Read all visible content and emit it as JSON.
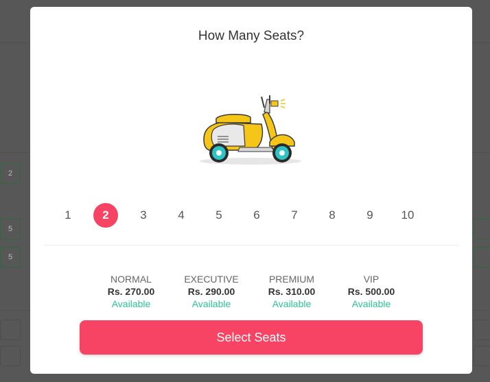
{
  "modal": {
    "title": "How Many Seats?",
    "seat_counts": [
      "1",
      "2",
      "3",
      "4",
      "5",
      "6",
      "7",
      "8",
      "9",
      "10"
    ],
    "selected_count": "2",
    "categories": [
      {
        "name": "NORMAL",
        "price": "Rs. 270.00",
        "status": "Available"
      },
      {
        "name": "EXECUTIVE",
        "price": "Rs. 290.00",
        "status": "Available"
      },
      {
        "name": "PREMIUM",
        "price": "Rs. 310.00",
        "status": "Available"
      },
      {
        "name": "VIP",
        "price": "Rs. 500.00",
        "status": "Available"
      }
    ],
    "select_button_label": "Select Seats",
    "illustration": "scooter-icon"
  },
  "background": {
    "seat_labels": [
      "2",
      "5",
      "5"
    ]
  },
  "colors": {
    "accent": "#f84464",
    "available": "#2dc492",
    "overlay": "#575757",
    "scooter_body": "#f5c518",
    "wheel": "#2ec4c4"
  }
}
